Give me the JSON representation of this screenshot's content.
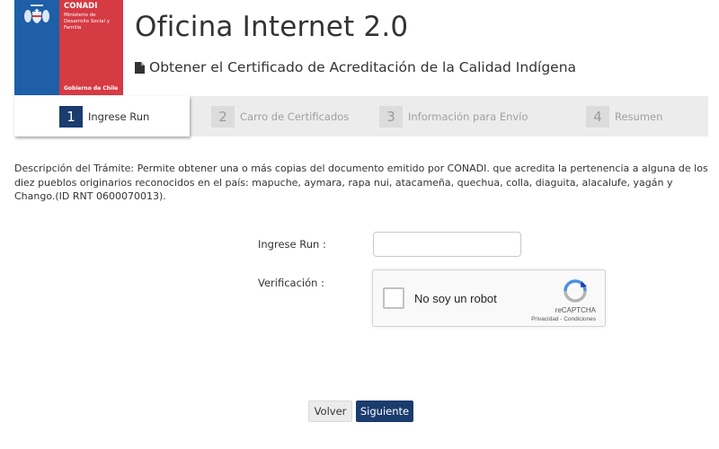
{
  "logo": {
    "name": "CONADI",
    "ministry": "Ministerio de Desarrollo Social y Familia",
    "government": "Gobierno de Chile",
    "icon": "chile-coat-of-arms-icon",
    "colors": {
      "blue": "#1e5fa8",
      "red": "#d63a43"
    }
  },
  "header": {
    "title": "Oficina Internet 2.0",
    "subtitle": "Obtener el Certificado de Acreditación de la Calidad Indígena",
    "subtitle_icon": "document-icon"
  },
  "steps": [
    {
      "number": "1",
      "label": "Ingrese Run",
      "active": true
    },
    {
      "number": "2",
      "label": "Carro de Certificados",
      "active": false
    },
    {
      "number": "3",
      "label": "Información para Envío",
      "active": false
    },
    {
      "number": "4",
      "label": "Resumen",
      "active": false
    }
  ],
  "description": "Descripción del Trámite: Permite obtener una o más copias del documento emitido por CONADI. que acredita la pertenencia a alguna de los diez pueblos originarios reconocidos en el país: mapuche, aymara, rapa nui, atacameña, quechua, colla, diaguita, alacalufe, yagán y Chango.(ID RNT 0600070013).",
  "form": {
    "run_label": "Ingrese Run :",
    "run_value": "",
    "verification_label": "Verificación :"
  },
  "captcha": {
    "text": "No soy un robot",
    "brand": "reCAPTCHA",
    "links": "Privacidad - Condiciones",
    "checked": false
  },
  "buttons": {
    "back": "Volver",
    "next": "Siguiente"
  },
  "colors": {
    "accent": "#1a3c6e",
    "step_bar": "#ececec"
  }
}
